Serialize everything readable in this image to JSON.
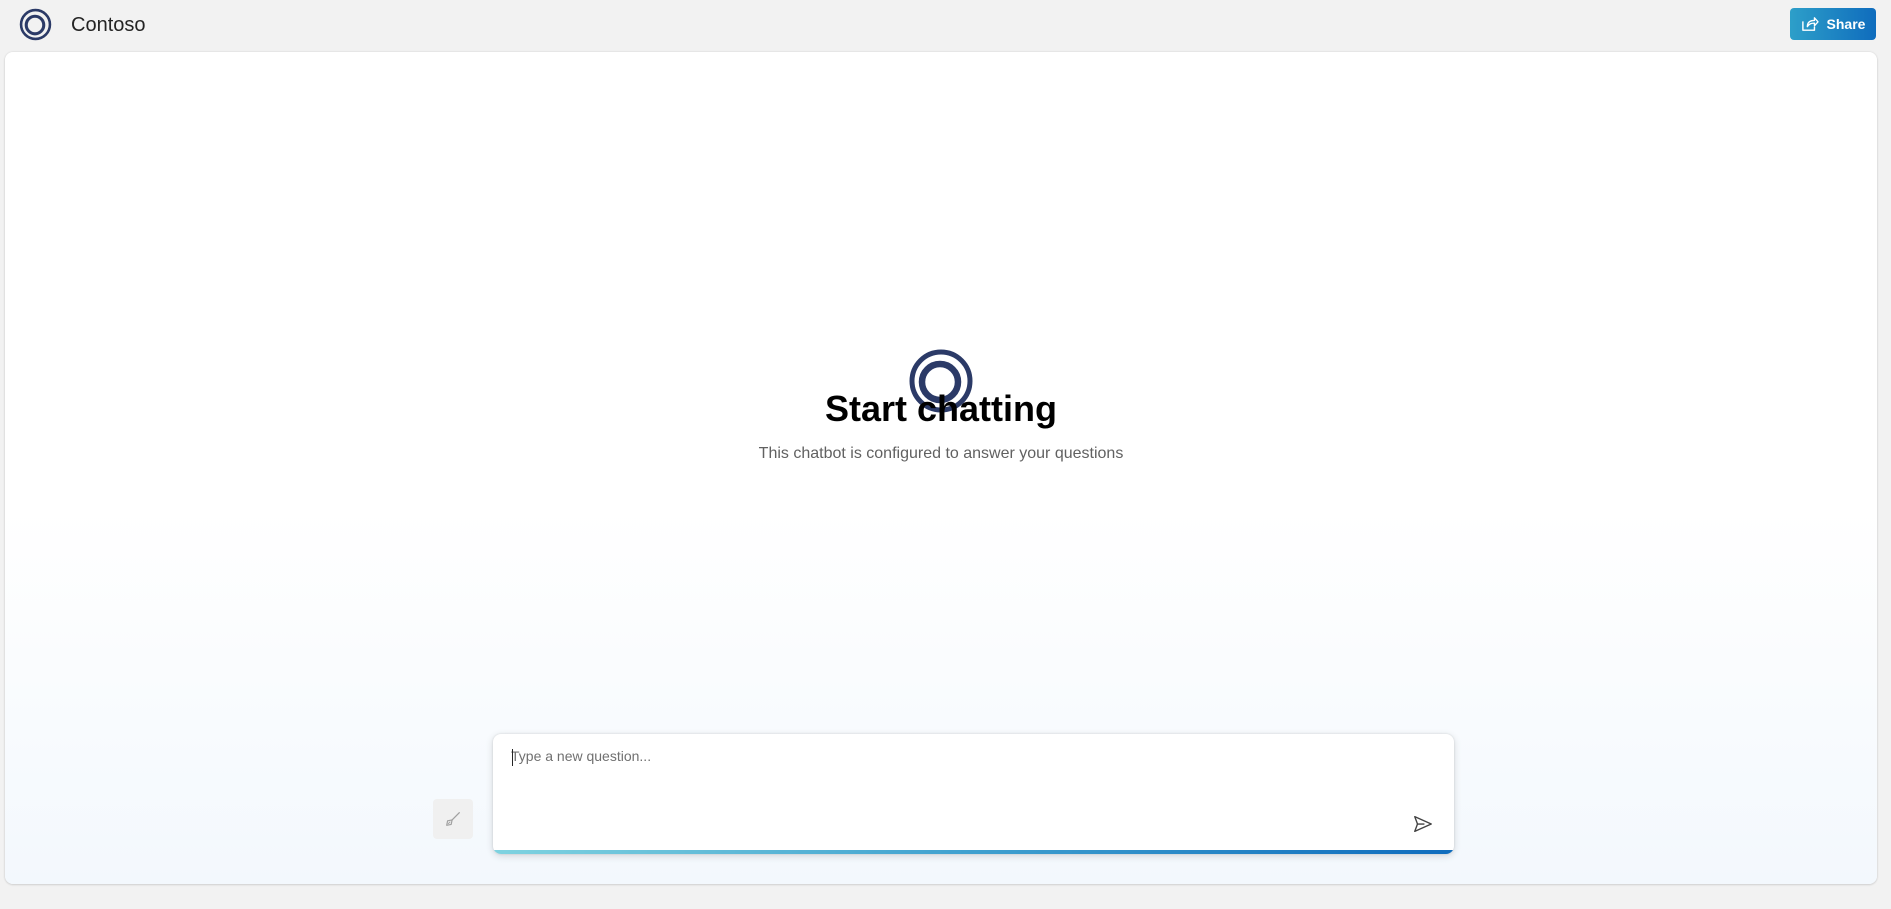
{
  "header": {
    "app_title": "Contoso",
    "logo_icon": "contoso-ring-logo-icon",
    "share_label": "Share",
    "share_icon": "share-icon"
  },
  "hero": {
    "logo_icon": "contoso-ring-logo-icon",
    "title": "Start chatting",
    "subtitle": "This chatbot is configured to answer your questions"
  },
  "chat": {
    "placeholder": "Type a new question...",
    "value": "",
    "clear_icon": "broom-icon",
    "send_icon": "send-icon"
  },
  "colors": {
    "brand": "#2b3a67",
    "accent": "#0f6cbd",
    "accent_light": "#2d9fc9"
  }
}
